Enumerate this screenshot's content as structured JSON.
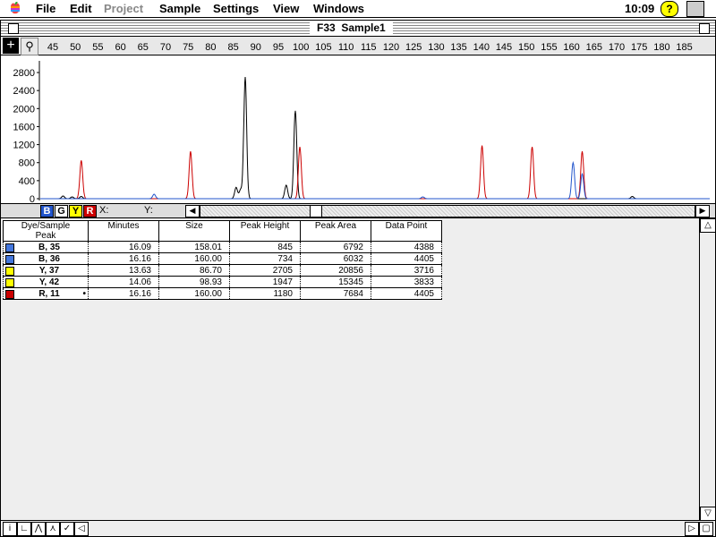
{
  "menubar": {
    "apple": "",
    "items": [
      {
        "label": "File",
        "enabled": true
      },
      {
        "label": "Edit",
        "enabled": true
      },
      {
        "label": "Project",
        "enabled": false
      },
      {
        "label": "Sample",
        "enabled": true
      },
      {
        "label": "Settings",
        "enabled": true
      },
      {
        "label": "View",
        "enabled": true
      },
      {
        "label": "Windows",
        "enabled": true
      }
    ],
    "clock": "10:09",
    "help": "?"
  },
  "window": {
    "title": "F33  Sample1"
  },
  "ruler": {
    "ticks": [
      "45",
      "50",
      "55",
      "60",
      "65",
      "70",
      "75",
      "80",
      "85",
      "90",
      "95",
      "100",
      "105",
      "110",
      "115",
      "120",
      "125",
      "130",
      "135",
      "140",
      "145",
      "150",
      "155",
      "160",
      "165",
      "170",
      "175",
      "180",
      "185"
    ]
  },
  "chart_data": {
    "type": "line",
    "y_ticks": [
      "2800",
      "2400",
      "2000",
      "1600",
      "1200",
      "800",
      "400",
      "0"
    ],
    "ylim": [
      0,
      2900
    ],
    "xlim": [
      41,
      188
    ],
    "series": [
      {
        "color": "#000000",
        "peaks": [
          [
            46,
            60
          ],
          [
            48,
            40
          ],
          [
            50,
            50
          ],
          [
            86,
            2700
          ],
          [
            85,
            200
          ],
          [
            84,
            250
          ],
          [
            97,
            1950
          ],
          [
            95,
            300
          ],
          [
            171,
            50
          ]
        ]
      },
      {
        "color": "#cc0000",
        "peaks": [
          [
            50,
            850
          ],
          [
            74,
            1050
          ],
          [
            98,
            1150
          ],
          [
            138,
            1180
          ],
          [
            149,
            1150
          ],
          [
            160,
            1050
          ]
        ]
      },
      {
        "color": "#2255cc",
        "peaks": [
          [
            66,
            100
          ],
          [
            158,
            800
          ],
          [
            160,
            550
          ],
          [
            125,
            40
          ]
        ]
      }
    ],
    "x_readout": "X:",
    "y_readout": "Y:"
  },
  "dyes": [
    {
      "label": "B",
      "color": "#2255cc"
    },
    {
      "label": "G",
      "color": "#ffffff"
    },
    {
      "label": "Y",
      "color": "#ffff00"
    },
    {
      "label": "R",
      "color": "#cc0000"
    }
  ],
  "table": {
    "headers": [
      "Dye/Sample\nPeak",
      "Minutes",
      "Size",
      "Peak Height",
      "Peak Area",
      "Data Point"
    ],
    "rows": [
      {
        "dye": "B, 35",
        "color": "#4477dd",
        "minutes": "16.09",
        "size": "158.01",
        "height": "845",
        "area": "6792",
        "point": "4388",
        "mark": ""
      },
      {
        "dye": "B, 36",
        "color": "#4477dd",
        "minutes": "16.16",
        "size": "160.00",
        "height": "734",
        "area": "6032",
        "point": "4405",
        "mark": ""
      },
      {
        "dye": "Y, 37",
        "color": "#ffff00",
        "minutes": "13.63",
        "size": "86.70",
        "height": "2705",
        "area": "20856",
        "point": "3716",
        "mark": ""
      },
      {
        "dye": "Y, 42",
        "color": "#ffff00",
        "minutes": "14.06",
        "size": "98.93",
        "height": "1947",
        "area": "15345",
        "point": "3833",
        "mark": ""
      },
      {
        "dye": "R, 11",
        "color": "#cc0000",
        "minutes": "16.16",
        "size": "160.00",
        "height": "1180",
        "area": "7684",
        "point": "4405",
        "mark": "•"
      }
    ]
  }
}
